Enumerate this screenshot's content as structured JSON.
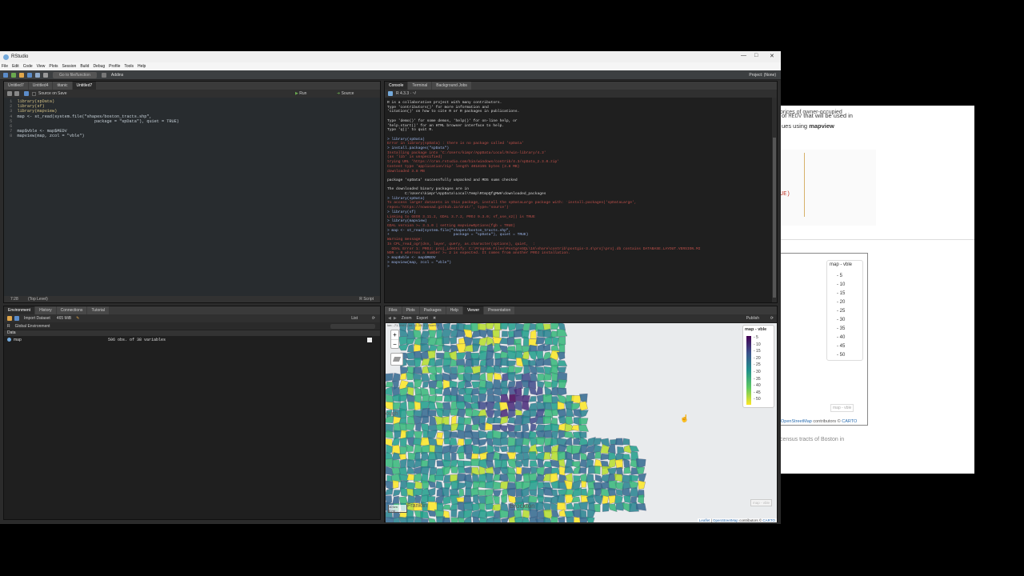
{
  "window": {
    "title": "RStudio",
    "minimize": "—",
    "maximize": "□",
    "close": "✕"
  },
  "menu": [
    "File",
    "Edit",
    "Code",
    "View",
    "Plots",
    "Session",
    "Build",
    "Debug",
    "Profile",
    "Tools",
    "Help"
  ],
  "toolbar": {
    "goto": "Go to file/function",
    "addins": "Addins",
    "project": "Project: (None)"
  },
  "source": {
    "tabs": [
      "Untitled7",
      "Untitled4",
      "titanic",
      "Untitled7"
    ],
    "source_on_save": "Source on Save",
    "run": "Run",
    "source_btn": "Source",
    "lines": [
      {
        "n": "1",
        "code": "library(spData)"
      },
      {
        "n": "2",
        "code": "library(sf)"
      },
      {
        "n": "3",
        "code": "library(mapview)"
      },
      {
        "n": "4",
        "code": "map <- st_read(system.file(\"shapes/boston_tracts.shp\","
      },
      {
        "n": "5",
        "code": "                               package = \"spData\"), quiet = TRUE)"
      },
      {
        "n": "6",
        "code": ""
      },
      {
        "n": "7",
        "code": "map$vble <- map$MEDV"
      },
      {
        "n": "8",
        "code": "mapview(map, zcol = \"vble\")"
      }
    ],
    "status_pos": "7:28",
    "status_level": "(Top Level)",
    "status_type": "R Script"
  },
  "console": {
    "tabs": [
      "Console",
      "Terminal",
      "Background Jobs"
    ],
    "version": "R 4.3.3 · ~/",
    "lines": [
      {
        "t": "R is a collaborative project with many contributors.",
        "c": "w"
      },
      {
        "t": "Type 'contributors()' for more information and",
        "c": "w"
      },
      {
        "t": "'citation()' on how to cite R or R packages in publications.",
        "c": "w"
      },
      {
        "t": "",
        "c": "w"
      },
      {
        "t": "Type 'demo()' for some demos, 'help()' for on-line help, or",
        "c": "w"
      },
      {
        "t": "'help.start()' for an HTML browser interface to help.",
        "c": "w"
      },
      {
        "t": "Type 'q()' to quit R.",
        "c": "w"
      },
      {
        "t": "",
        "c": "w"
      },
      {
        "t": "> library(spData)",
        "c": "b"
      },
      {
        "t": "Error in library(spData) : there is no package called 'spData'",
        "c": "r"
      },
      {
        "t": "> install.packages(\"spData\")",
        "c": "b"
      },
      {
        "t": "Installing package into 'C:/Users/kimpr/AppData/Local/R/win-library/4.3'",
        "c": "r"
      },
      {
        "t": "(as 'lib' is unspecified)",
        "c": "r"
      },
      {
        "t": "trying URL 'https://cran.rstudio.com/bin/windows/contrib/4.3/spData_2.3.0.zip'",
        "c": "r"
      },
      {
        "t": "Content type 'application/zip' length 4018155 bytes (3.8 MB)",
        "c": "r"
      },
      {
        "t": "downloaded 3.8 MB",
        "c": "r"
      },
      {
        "t": "",
        "c": "w"
      },
      {
        "t": "package 'spData' successfully unpacked and MD5 sums checked",
        "c": "w"
      },
      {
        "t": "",
        "c": "w"
      },
      {
        "t": "The downloaded binary packages are in",
        "c": "w"
      },
      {
        "t": "        C:\\Users\\kimpr\\AppData\\Local\\Temp\\RtmpQfgMWH\\downloaded_packages",
        "c": "w"
      },
      {
        "t": "> library(spData)",
        "c": "b"
      },
      {
        "t": "To access larger datasets in this package, install the spDataLarge package with: `install.packages('spDataLarge',",
        "c": "r"
      },
      {
        "t": "repos='https://nowosad.github.io/drat/', type='source')`",
        "c": "r"
      },
      {
        "t": "> library(sf)",
        "c": "b"
      },
      {
        "t": "Linking to GEOS 3.11.2, GDAL 3.7.2, PROJ 9.3.0; sf_use_s2() is TRUE",
        "c": "r"
      },
      {
        "t": "> library(mapview)",
        "c": "b"
      },
      {
        "t": "GDAL version >= 3.1.0 | setting mapviewOptions(fgb = TRUE)",
        "c": "r"
      },
      {
        "t": "> map <- st_read(system.file(\"shapes/boston_tracts.shp\",",
        "c": "b"
      },
      {
        "t": "+                             package = \"spData\"), quiet = TRUE)",
        "c": "b"
      },
      {
        "t": "Warning message:",
        "c": "r"
      },
      {
        "t": "In CPL_read_ogr(dsn, layer, query, as.character(options), quiet,  :",
        "c": "r"
      },
      {
        "t": "  GDAL Error 1: PROJ: proj_identify: C:\\Program Files\\PostgreSQL\\16\\share\\contrib\\postgis-3.4\\proj\\proj.db contains DATABASE.LAYOUT.VERSION.MI",
        "c": "r"
      },
      {
        "t": "NOR = 0 whereas a number >= 2 is expected. It comes from another PROJ installation.",
        "c": "r"
      },
      {
        "t": "> map$vble <- map$MEDV",
        "c": "b"
      },
      {
        "t": "> mapview(map, zcol = \"vble\")",
        "c": "b"
      },
      {
        "t": ">",
        "c": "b"
      }
    ]
  },
  "environment": {
    "tabs": [
      "Environment",
      "History",
      "Connections",
      "Tutorial"
    ],
    "import": "Import Dataset",
    "memory": "465 MiB",
    "scope": "R",
    "global": "Global Environment",
    "list": "List",
    "section": "Data",
    "row_name": "map",
    "row_value": "506 obs. of 38 variables"
  },
  "viewer": {
    "tabs": [
      "Files",
      "Plots",
      "Packages",
      "Help",
      "Viewer",
      "Presentation"
    ],
    "zoom": "Zoom",
    "export": "Export",
    "publish": "Publish",
    "coords": "lon: -71.3983 | lat: 42.3401 | zoom: 9",
    "city_brockton": "Brockton",
    "city_franklin": "Franklin",
    "edge_label": "ough",
    "scale_km": "10 km",
    "scale_mi": "5 mi",
    "attribution_leaflet": "Leaflet",
    "attribution_osm": "OpenStreetMap",
    "attribution_rest": "contributors ©",
    "attribution_carto": "CARTO",
    "bottom_badge": "map - vble",
    "legend_title": "map - vble",
    "legend_values": [
      "5",
      "10",
      "15",
      "20",
      "25",
      "30",
      "35",
      "40",
      "45",
      "50"
    ]
  },
  "background_doc": {
    "line1": "prices of owner-occupied",
    "line2a": "of",
    "line2code": "MEDV",
    "line2b": "that will be used in",
    "line3a": "ues using",
    "line3b": "mapview",
    "red_snip": "UE)",
    "legend_title": "map - vble",
    "legend_values": [
      "5",
      "10",
      "15",
      "20",
      "25",
      "30",
      "35",
      "40",
      "45",
      "50"
    ],
    "badge": "map - vble",
    "osm": "OpenStreetMap",
    "contrib": "contributors ©",
    "carto": "CARTO",
    "caption": "census tracts of Boston in"
  },
  "colors": {
    "accent": "#75aadb",
    "viridis_dark": "#440154",
    "viridis_mid": "#21918c",
    "viridis_light": "#fde725"
  }
}
